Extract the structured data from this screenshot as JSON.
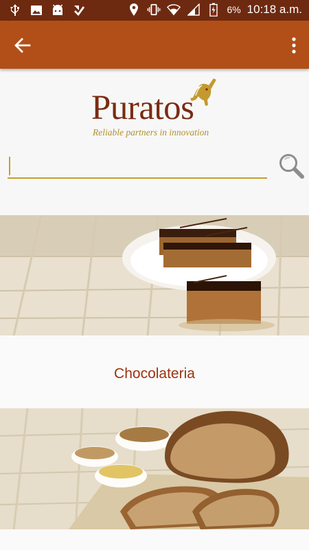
{
  "status_bar": {
    "battery_percent": "6%",
    "time": "10:18 a.m.",
    "left_icons": [
      "usb-icon",
      "image-icon",
      "android-icon",
      "download-check-icon"
    ],
    "right_icons": [
      "location-icon",
      "vibrate-icon",
      "wifi-icon",
      "signal-icon",
      "battery-icon"
    ]
  },
  "app_bar": {
    "back_icon": "arrow-left-icon",
    "menu_icon": "more-vert-icon",
    "background": "#b24f18"
  },
  "logo": {
    "wordmark": "Puratos",
    "tagline": "Reliable partners in innovation",
    "emblem": "unicorn-head-icon"
  },
  "search": {
    "value": "",
    "icon": "search-icon",
    "accent": "#c2a032"
  },
  "categories": [
    {
      "label": "Chocolateria",
      "image": "chocolate-cake-bars-photo"
    },
    {
      "label": "",
      "image": "bread-and-grains-photo"
    }
  ],
  "colors": {
    "status_bar": "#6e2a10",
    "label_text": "#9b3311",
    "logo_text": "#7a2b12",
    "tagline": "#b1912e"
  }
}
